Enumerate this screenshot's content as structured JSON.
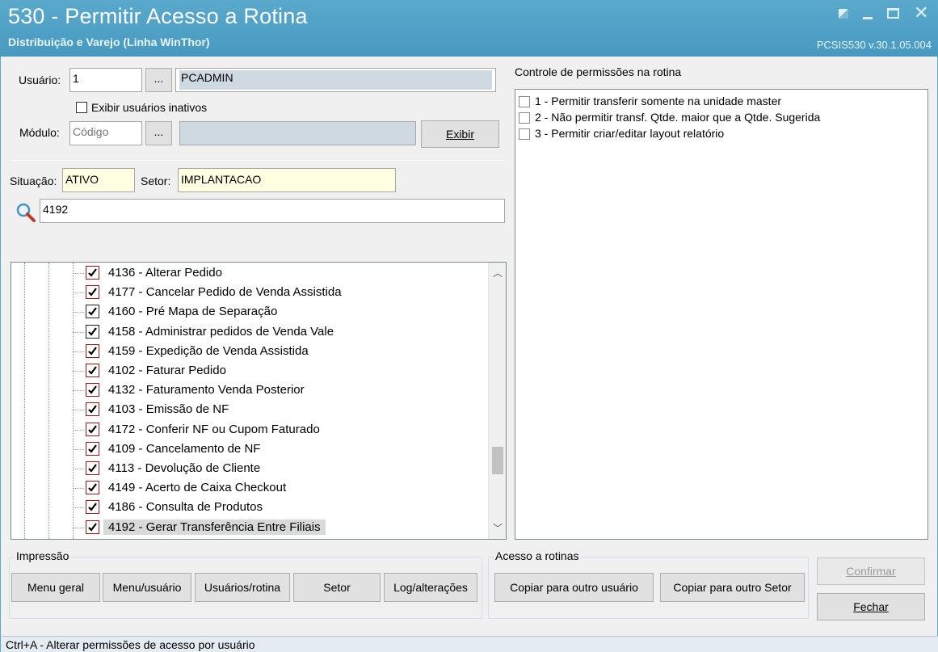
{
  "window": {
    "title": "530 - Permitir Acesso a Rotina",
    "subtitle": "Distribuição e Varejo (Linha WinThor)",
    "version": "PCSIS530  v.30.1.05.004"
  },
  "filters": {
    "usuario_label": "Usuário:",
    "usuario_code": "1",
    "usuario_lookup": "...",
    "usuario_name": "PCADMIN",
    "inativos_label": "Exibir usuários inativos",
    "inativos_checked": false,
    "modulo_label": "Módulo:",
    "modulo_placeholder": "Código",
    "modulo_lookup": "...",
    "modulo_name": "",
    "exibir_button": "Exibir",
    "situacao_label": "Situação:",
    "situacao_value": "ATIVO",
    "setor_label": "Setor:",
    "setor_value": "IMPLANTACAO",
    "search_value": "4192"
  },
  "tree": {
    "items": [
      {
        "label": "4136 - Alterar Pedido",
        "checked": true,
        "style": "red"
      },
      {
        "label": "4177 - Cancelar Pedido de Venda Assistida",
        "checked": true,
        "style": "red"
      },
      {
        "label": "4160 - Pré Mapa de Separação",
        "checked": true,
        "style": "black"
      },
      {
        "label": "4158 - Administrar pedidos de Venda Vale",
        "checked": true,
        "style": "black"
      },
      {
        "label": "4159 - Expedição de Venda Assistida",
        "checked": true,
        "style": "red"
      },
      {
        "label": "4102 - Faturar Pedido",
        "checked": true,
        "style": "red"
      },
      {
        "label": "4132 - Faturamento Venda Posterior",
        "checked": true,
        "style": "red"
      },
      {
        "label": "4103 - Emissão de NF",
        "checked": true,
        "style": "red"
      },
      {
        "label": "4172 - Conferir NF ou Cupom Faturado",
        "checked": true,
        "style": "red"
      },
      {
        "label": "4109 - Cancelamento de NF",
        "checked": true,
        "style": "red"
      },
      {
        "label": "4113 - Devolução de Cliente",
        "checked": true,
        "style": "red"
      },
      {
        "label": "4149 - Acerto de Caixa Checkout",
        "checked": true,
        "style": "red"
      },
      {
        "label": "4186 - Consulta de Produtos",
        "checked": true,
        "style": "red"
      },
      {
        "label": "4192 - Gerar Transferência Entre Filiais",
        "checked": true,
        "style": "red",
        "selected": true
      }
    ],
    "scroll_position": 0.78
  },
  "permissions": {
    "title": "Controle de permissões na rotina",
    "items": [
      {
        "label": "1 - Permitir transferir somente na unidade master",
        "checked": false
      },
      {
        "label": "2 - Não permitir transf. Qtde. maior que a Qtde. Sugerida",
        "checked": false
      },
      {
        "label": "3 - Permitir criar/editar layout relatório",
        "checked": false
      }
    ]
  },
  "impressao": {
    "title": "Impressão",
    "buttons": [
      "Menu geral",
      "Menu/usuário",
      "Usuários/rotina",
      "Setor",
      "Log/alterações"
    ]
  },
  "acesso": {
    "title": "Acesso a rotinas",
    "buttons": [
      "Copiar para outro usuário",
      "Copiar para outro Setor"
    ]
  },
  "actions": {
    "confirmar": "Confirmar",
    "fechar": "Fechar"
  },
  "status_bar": "Ctrl+A - Alterar permissões de acesso por usuário",
  "colors": {
    "titlebar": "#4799c0",
    "check_red": "#a51616",
    "highlight_yellow": "#ffffe1"
  }
}
